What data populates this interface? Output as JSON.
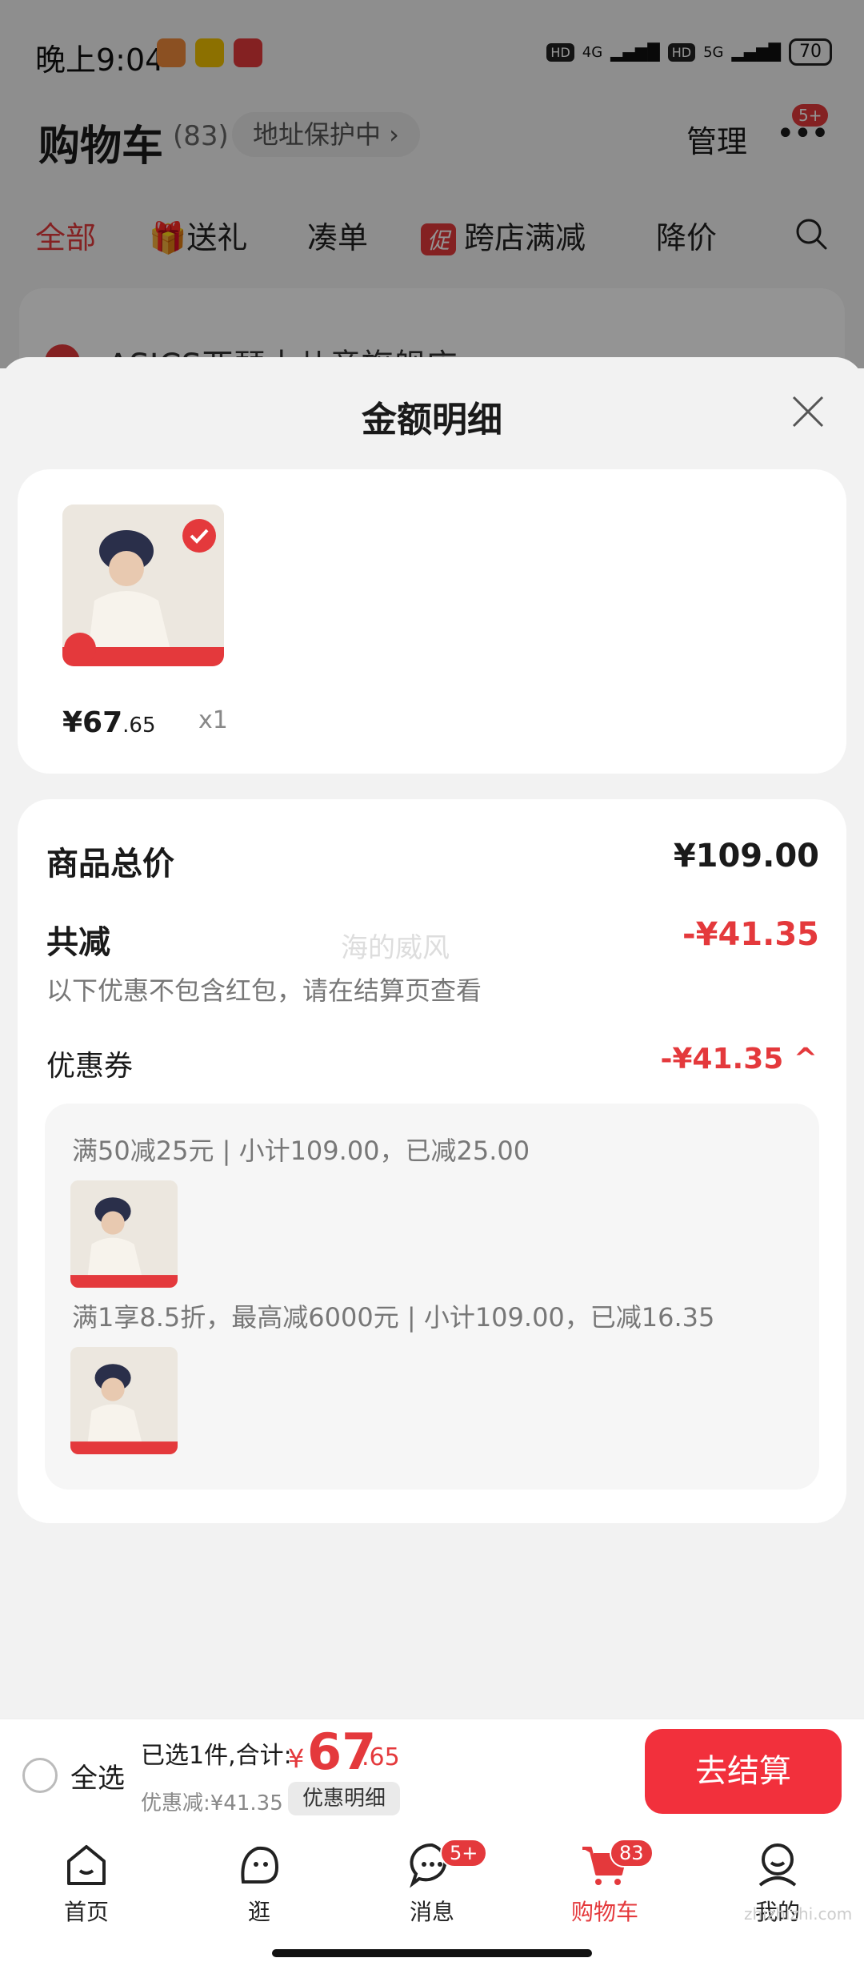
{
  "status_bar": {
    "time": "晚上9:04",
    "net1": "4G",
    "net2": "5G",
    "hd": "HD",
    "battery": "70"
  },
  "cart_header": {
    "title": "购物车",
    "count": "(83)",
    "address_protect": "地址保护中 ›",
    "manage": "管理",
    "more_badge": "5+"
  },
  "filter_tabs": {
    "all": "全部",
    "gift": "送礼",
    "combine": "凑单",
    "promo_tag": "促",
    "cross_store": "跨店满减",
    "price_drop": "降价"
  },
  "store_peek": {
    "name": "ASICS亚瑟士儿童旗舰店 ›"
  },
  "sheet": {
    "title": "金额明细",
    "product": {
      "price_int": "¥67",
      "price_dec": ".65",
      "qty": "x1"
    },
    "summary": {
      "total_label": "商品总价",
      "total_value": "¥109.00",
      "reduce_label": "共减",
      "reduce_value": "-¥41.35",
      "note": "以下优惠不包含红包，请在结算页查看",
      "watermark": "海的威风",
      "coupon_label": "优惠券",
      "coupon_value": "-¥41.35 ^"
    },
    "rules": [
      {
        "text": "满50减25元 | 小计109.00，已减25.00"
      },
      {
        "text": "满1享8.5折，最高减6000元 | 小计109.00，已减16.35"
      }
    ]
  },
  "checkout": {
    "select_all": "全选",
    "selected_text": "已选1件,合计:",
    "currency": "¥",
    "total_int": "67",
    "total_dec": ".65",
    "discount_text": "优惠减:¥41.35",
    "detail_btn": "优惠明细",
    "checkout_btn": "去结算"
  },
  "nav": {
    "items": [
      {
        "label": "首页"
      },
      {
        "label": "逛"
      },
      {
        "label": "消息",
        "badge": "5+"
      },
      {
        "label": "购物车",
        "badge": "83"
      },
      {
        "label": "我的"
      }
    ],
    "site_mark": "zhizhizhi.com"
  },
  "colors": {
    "accent": "#e4393c",
    "checkout": "#f2303c",
    "panel_bg": "#f2f2f2"
  }
}
